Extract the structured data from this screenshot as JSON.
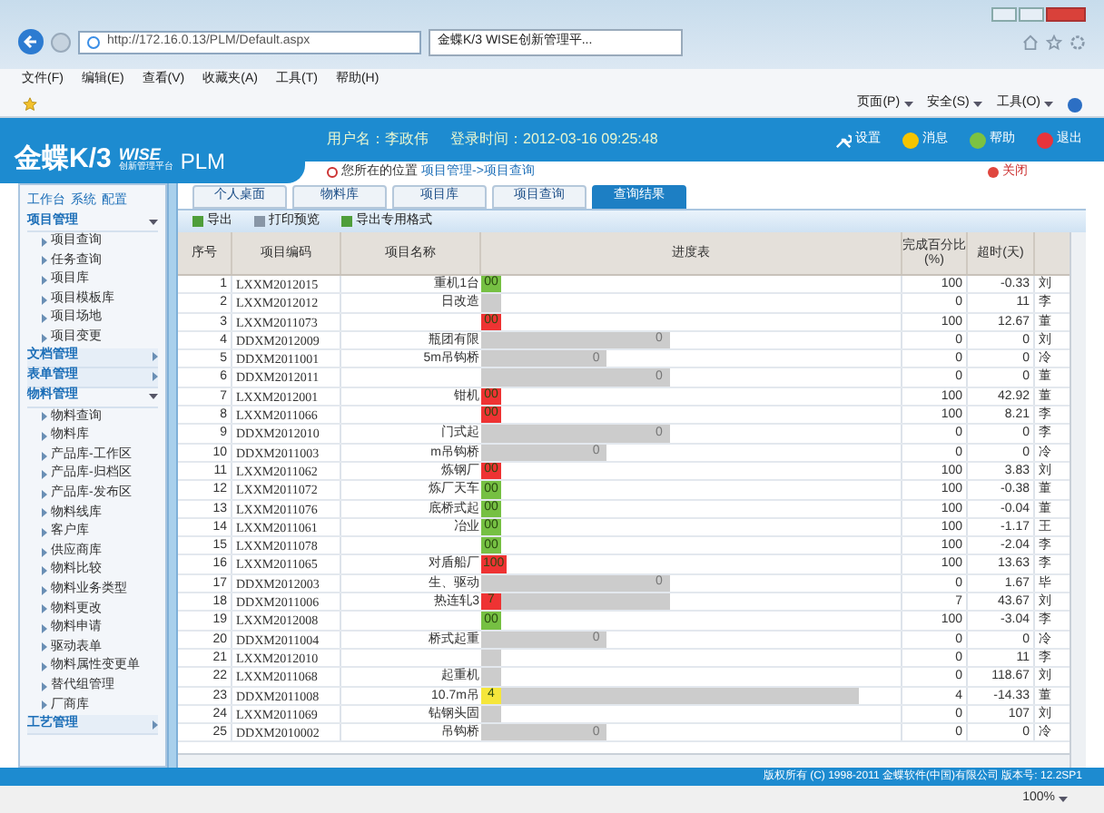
{
  "browser": {
    "address": "http://172.16.0.13/PLM/Default.aspx",
    "tab_title": "金蝶K/3 WISE创新管理平...",
    "menu": [
      "文件(F)",
      "编辑(E)",
      "查看(V)",
      "收藏夹(A)",
      "工具(T)",
      "帮助(H)"
    ],
    "toolbar_menus": [
      "页面(P)",
      "安全(S)",
      "工具(O)"
    ]
  },
  "header": {
    "logo": {
      "brand": "金蝶K/3",
      "wise": "WISE",
      "subtitle": "创新管理平台",
      "product": "PLM"
    },
    "user": "用户名：李政伟",
    "login_time": "登录时间：2012-03-16 09:25:48",
    "actions": [
      {
        "kind": "settings",
        "label": "设置"
      },
      {
        "kind": "message",
        "label": "消息"
      },
      {
        "kind": "help",
        "label": "帮助"
      },
      {
        "kind": "logout",
        "label": "退出"
      }
    ]
  },
  "breadcrumb": {
    "prefix": "您所在的位置",
    "path": "项目管理->项目查询"
  },
  "close": "关闭",
  "sidebar": {
    "links": [
      "工作台",
      "系统",
      "配置"
    ],
    "groups": [
      {
        "label": "项目管理",
        "expanded": true,
        "children": [
          "项目查询",
          "任务查询",
          "项目库",
          "项目模板库",
          "项目场地",
          "项目变更"
        ]
      },
      {
        "label": "文档管理",
        "expanded": false
      },
      {
        "label": "表单管理",
        "expanded": false
      },
      {
        "label": "物料管理",
        "expanded": true,
        "children": [
          "物料查询",
          "物料库",
          "产品库-工作区",
          "产品库-归档区",
          "产品库-发布区",
          "物料线库",
          "客户库",
          "供应商库",
          "物料比较",
          "物料业务类型",
          "物料更改",
          "物料申请",
          "驱动表单",
          "物料属性变更单",
          "替代组管理",
          "厂商库"
        ]
      },
      {
        "label": "工艺管理",
        "expanded": false
      }
    ]
  },
  "tabs": [
    {
      "label": "个人桌面",
      "selected": false
    },
    {
      "label": "物料库",
      "selected": false
    },
    {
      "label": "项目库",
      "selected": false
    },
    {
      "label": "项目查询",
      "selected": false
    },
    {
      "label": "查询结果",
      "selected": true
    }
  ],
  "toolbar": [
    {
      "kind": "export",
      "label": "导出"
    },
    {
      "kind": "print",
      "label": "打印预览"
    },
    {
      "kind": "export",
      "label": "导出专用格式"
    }
  ],
  "table": {
    "columns": [
      "序号",
      "项目编码",
      "项目名称",
      "进度表",
      "完成百分比(%)",
      "超时(天)"
    ],
    "rows": [
      {
        "no": "1",
        "code": "LXXM2012015",
        "name": "重机1台",
        "status": {
          "text": "00",
          "color": "#76c043"
        },
        "percent": "100",
        "overdue": "-0.33",
        "owner": "刘"
      },
      {
        "no": "2",
        "code": "LXXM2012012",
        "name": "日改造",
        "status": {
          "color": "#cccccc"
        },
        "percent": "0",
        "overdue": "11",
        "owner": "李"
      },
      {
        "no": "3",
        "code": "LXXM2011073",
        "status": {
          "text": "00",
          "color": "#ee3333"
        },
        "percent": "100",
        "overdue": "12.67",
        "owner": "董"
      },
      {
        "no": "4",
        "code": "DDXM2012009",
        "name": "瓶团有限",
        "bar": {
          "level": 0.45,
          "label": "0"
        },
        "percent": "0",
        "overdue": "0",
        "owner": "刘"
      },
      {
        "no": "5",
        "code": "DDXM2011001",
        "name": "5m吊钩桥",
        "bar": {
          "level": 0.3,
          "label": "0"
        },
        "percent": "0",
        "overdue": "0",
        "owner": "冷"
      },
      {
        "no": "6",
        "code": "DDXM2012011",
        "bar": {
          "level": 0.45,
          "label": "0"
        },
        "percent": "0",
        "overdue": "0",
        "owner": "董"
      },
      {
        "no": "7",
        "code": "LXXM2012001",
        "name": "钳机",
        "status": {
          "text": "00",
          "color": "#ee3333"
        },
        "percent": "100",
        "overdue": "42.92",
        "owner": "董"
      },
      {
        "no": "8",
        "code": "LXXM2011066",
        "status": {
          "text": "00",
          "color": "#ee3333"
        },
        "percent": "100",
        "overdue": "8.21",
        "owner": "李"
      },
      {
        "no": "9",
        "code": "DDXM2012010",
        "name": "门式起",
        "bar": {
          "level": 0.45,
          "label": "0"
        },
        "percent": "0",
        "overdue": "0",
        "owner": "李"
      },
      {
        "no": "10",
        "code": "DDXM2011003",
        "name": "m吊钩桥",
        "bar": {
          "level": 0.3,
          "label": "0"
        },
        "percent": "0",
        "overdue": "0",
        "owner": "冷"
      },
      {
        "no": "11",
        "code": "LXXM2011062",
        "name": "炼钢厂",
        "status": {
          "text": "00",
          "color": "#ee3333"
        },
        "percent": "100",
        "overdue": "3.83",
        "owner": "刘"
      },
      {
        "no": "12",
        "code": "LXXM2011072",
        "name": "炼厂天车",
        "status": {
          "text": "00",
          "color": "#76c043"
        },
        "percent": "100",
        "overdue": "-0.38",
        "owner": "董"
      },
      {
        "no": "13",
        "code": "LXXM2011076",
        "name": "底桥式起",
        "status": {
          "text": "00",
          "color": "#76c043"
        },
        "percent": "100",
        "overdue": "-0.04",
        "owner": "董"
      },
      {
        "no": "14",
        "code": "LXXM2011061",
        "name": "冶业",
        "status": {
          "text": "00",
          "color": "#76c043"
        },
        "percent": "100",
        "overdue": "-1.17",
        "owner": "王"
      },
      {
        "no": "15",
        "code": "LXXM2011078",
        "status": {
          "text": "00",
          "color": "#76c043"
        },
        "percent": "100",
        "overdue": "-2.04",
        "owner": "李"
      },
      {
        "no": "16",
        "code": "LXXM2011065",
        "name": "对盾船厂",
        "status": {
          "text": "100",
          "color": "#ee3333"
        },
        "percent": "100",
        "overdue": "13.63",
        "owner": "李"
      },
      {
        "no": "17",
        "code": "DDXM2012003",
        "name": "生、驱动",
        "bar": {
          "level": 0.45,
          "label": "0"
        },
        "percent": "0",
        "overdue": "1.67",
        "owner": "毕"
      },
      {
        "no": "18",
        "code": "DDXM2011006",
        "name": "热连轧3",
        "status": {
          "text": "7",
          "color": "#ee3333"
        },
        "bar": {
          "level": 0.45
        },
        "percent": "7",
        "overdue": "43.67",
        "owner": "刘"
      },
      {
        "no": "19",
        "code": "LXXM2012008",
        "status": {
          "text": "00",
          "color": "#76c043"
        },
        "percent": "100",
        "overdue": "-3.04",
        "owner": "李"
      },
      {
        "no": "20",
        "code": "DDXM2011004",
        "name": "桥式起重",
        "bar": {
          "level": 0.3,
          "label": "0"
        },
        "percent": "0",
        "overdue": "0",
        "owner": "冷"
      },
      {
        "no": "21",
        "code": "LXXM2012010",
        "status": {
          "color": "#cccccc"
        },
        "percent": "0",
        "overdue": "11",
        "owner": "李"
      },
      {
        "no": "22",
        "code": "LXXM2011068",
        "name": "起重机",
        "status": {
          "color": "#cccccc"
        },
        "percent": "0",
        "overdue": "118.67",
        "owner": "刘"
      },
      {
        "no": "23",
        "code": "DDXM2011008",
        "name": "10.7m吊",
        "status": {
          "text": "4",
          "color": "#f5e63b"
        },
        "bar": {
          "level": 0.9
        },
        "percent": "4",
        "overdue": "-14.33",
        "owner": "董"
      },
      {
        "no": "24",
        "code": "LXXM2011069",
        "name": "钻钢头固",
        "status": {
          "color": "#cccccc"
        },
        "percent": "0",
        "overdue": "107",
        "owner": "刘"
      },
      {
        "no": "25",
        "code": "DDXM2010002",
        "name": "吊钩桥",
        "bar": {
          "level": 0.3,
          "label": "0"
        },
        "percent": "0",
        "overdue": "0",
        "owner": "冷"
      }
    ]
  },
  "footer": "版权所有 (C) 1998-2011 金蝶软件(中国)有限公司 版本号: 12.2SP1",
  "zoom": "100%"
}
